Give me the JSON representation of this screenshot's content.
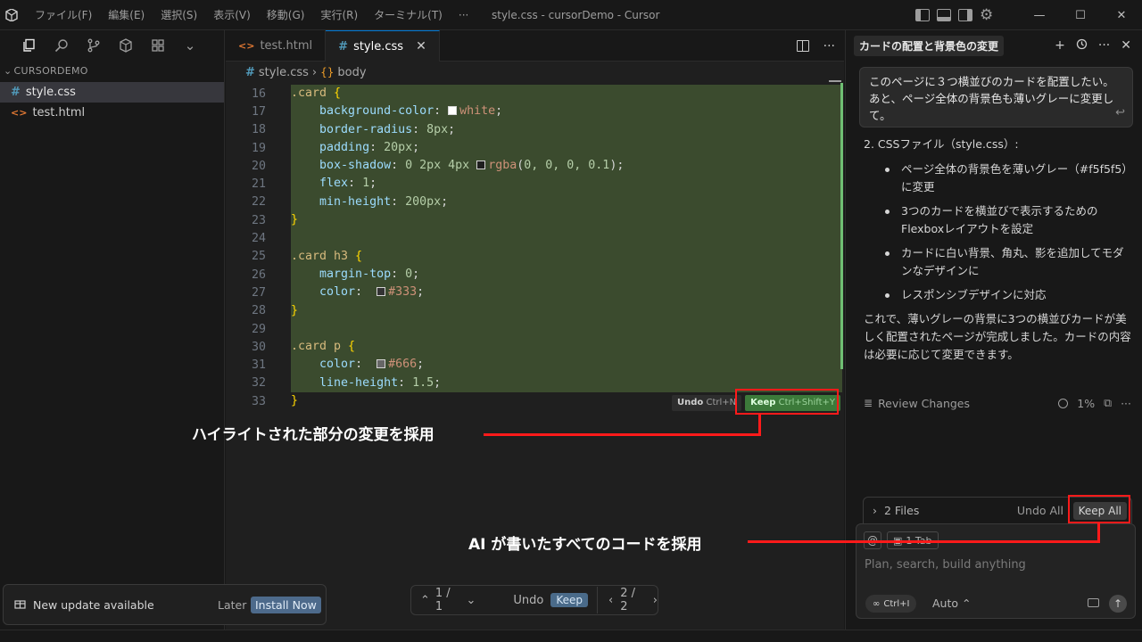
{
  "titlebar": {
    "menu": [
      "ファイル(F)",
      "編集(E)",
      "選択(S)",
      "表示(V)",
      "移動(G)",
      "実行(R)",
      "ターミナル(T)",
      "···"
    ],
    "window_title": "style.css - cursorDemo - Cursor",
    "minimize": "—",
    "maximize": "☐",
    "close": "✕"
  },
  "sidebar": {
    "section": "CURSORDEMO",
    "files": [
      {
        "name": "style.css",
        "icon": "#"
      },
      {
        "name": "test.html",
        "icon": "<>"
      }
    ]
  },
  "editor": {
    "tabs": [
      {
        "label": "test.html",
        "icon": "<>"
      },
      {
        "label": "style.css",
        "icon": "#"
      }
    ],
    "breadcrumb": {
      "file": "style.css",
      "symbol": "body"
    },
    "line_numbers": [
      "16",
      "17",
      "18",
      "19",
      "20",
      "21",
      "22",
      "23",
      "24",
      "25",
      "26",
      "27",
      "28",
      "29",
      "30",
      "31",
      "32",
      "33"
    ],
    "code": {
      "l16_sel": ".card",
      "l16_brace": " {",
      "l17_prop": "background-color",
      "l17_val": "white",
      "l18_prop": "border-radius",
      "l18_num": "8px",
      "l19_prop": "padding",
      "l19_num": "20px",
      "l20_prop": "box-shadow",
      "l20_num": "0 2px 4px",
      "l20_fn": "rgba",
      "l20_args": "0, 0, 0, 0.1",
      "l21_prop": "flex",
      "l21_num": "1",
      "l22_prop": "min-height",
      "l22_num": "200px",
      "l23": "}",
      "l25_sel": ".card h3",
      "l25_brace": " {",
      "l26_prop": "margin-top",
      "l26_num": "0",
      "l27_prop": "color",
      "l27_val": "#333",
      "l28": "}",
      "l30_sel": ".card p",
      "l30_brace": " {",
      "l31_prop": "color",
      "l31_val": "#666",
      "l32_prop": "line-height",
      "l32_num": "1.5",
      "l33": "}"
    },
    "inline_undo": {
      "label": "Undo",
      "shortcut": "Ctrl+N"
    },
    "inline_keep": {
      "label": "Keep",
      "shortcut": "Ctrl+Shift+Y"
    },
    "bottom_bar": {
      "prev": "1 / 1",
      "undo": "Undo",
      "keep": "Keep",
      "pager": "2 / 2"
    }
  },
  "toast": {
    "message": "New update available",
    "later": "Later",
    "install": "Install Now"
  },
  "chat": {
    "title": "カードの配置と背景色の変更",
    "user_message_1": "このページに３つ横並びのカードを配置したい。",
    "user_message_2": "あと、ページ全体の背景色も薄いグレーに変更して。",
    "response_heading": "2. CSSファイル（style.css）:",
    "bullets": [
      "ページ全体の背景色を薄いグレー（#f5f5f5）に変更",
      "3つのカードを横並びで表示するためのFlexboxレイアウトを設定",
      "カードに白い背景、角丸、影を追加してモダンなデザインに",
      "レスポンシブデザインに対応"
    ],
    "response_tail": "これで、薄いグレーの背景に3つの横並びカードが美しく配置されたページが完成しました。カードの内容は必要に応じて変更できます。",
    "review_changes": "Review Changes",
    "progress": "1%",
    "files_count": "2 Files",
    "undo_all": "Undo All",
    "keep_all": "Keep All",
    "at_symbol": "@",
    "tab_chip": "1 Tab",
    "placeholder": "Plan, search, build anything",
    "mode_chip": "Ctrl+I",
    "model": "Auto"
  },
  "annotations": {
    "keep_hunk": "ハイライトされた部分の変更を採用",
    "keep_all": "AI が書いたすべてのコードを採用"
  },
  "colors": {
    "diff_bg": "#3b4b2e",
    "annotation_red": "#ff1a1a",
    "accent": "#0078d4"
  }
}
